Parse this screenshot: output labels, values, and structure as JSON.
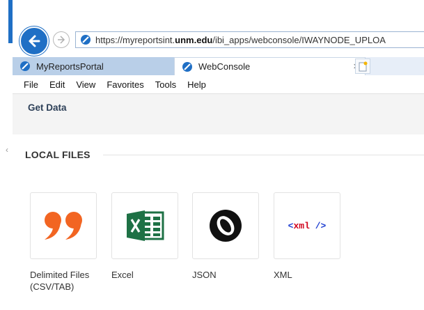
{
  "browser": {
    "url_prefix": "https://myreportsint.",
    "url_host": "unm.edu",
    "url_path": "/ibi_apps/webconsole/IWAYNODE_UPLOA",
    "tabs": [
      {
        "label": "MyReportsPortal",
        "active": false
      },
      {
        "label": "WebConsole",
        "active": true
      }
    ],
    "close_glyph": "×",
    "menu": [
      "File",
      "Edit",
      "View",
      "Favorites",
      "Tools",
      "Help"
    ]
  },
  "page": {
    "title": "Get Data",
    "section_title": "LOCAL FILES",
    "tiles": [
      {
        "label": "Delimited Files (CSV/TAB)",
        "icon": "quote-icon",
        "color": "#f26522"
      },
      {
        "label": "Excel",
        "icon": "excel-icon",
        "color": "#1e7145"
      },
      {
        "label": "JSON",
        "icon": "json-icon",
        "color": "#111111"
      },
      {
        "label": "XML",
        "icon": "xml-icon",
        "glyph": "<xml />",
        "colors": {
          "angle": "#1f3fd1",
          "text": "#d0021b"
        }
      }
    ]
  },
  "colors": {
    "accent": "#1f6fc5",
    "tab_inactive": "#b9cfe8",
    "header_bg": "#f4f4f4"
  }
}
